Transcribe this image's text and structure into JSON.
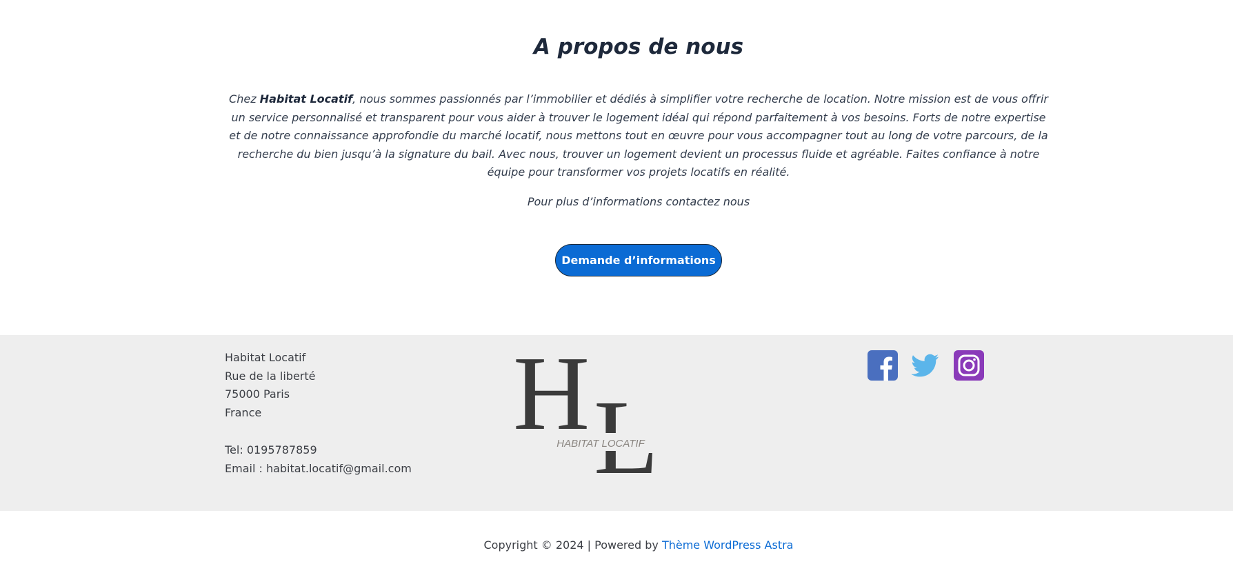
{
  "about": {
    "title": "A propos de nous",
    "intro_prefix": "Chez ",
    "company_name": "Habitat Locatif",
    "intro_body": ", nous sommes passionnés par l’immobilier et dédiés à simplifier votre recherche de location. Notre mission est de vous offrir un service personnalisé et transparent pour vous aider à trouver le logement idéal qui répond parfaitement à vos besoins. Forts de notre expertise et de notre connaissance approfondie du marché locatif, nous mettons tout en œuvre pour vous accompagner tout au long de votre parcours, de la recherche du bien jusqu’à la signature du bail. Avec nous, trouver un logement devient un processus fluide et agréable. Faites confiance à notre équipe pour transformer vos projets locatifs en réalité.",
    "contact_line": "Pour plus d’informations contactez nous",
    "cta_label": "Demande d’informations"
  },
  "footer": {
    "address": {
      "company": "Habitat Locatif",
      "street": "Rue de la liberté",
      "city": "75000 Paris",
      "country": "France",
      "phone": "Tel: 0195787859",
      "email": "Email : habitat.locatif@gmail.com"
    },
    "logo": {
      "monogram_top": "H",
      "monogram_bottom": "L",
      "tagline": "HABITAT LOCATIF"
    },
    "socials": [
      {
        "icon": "facebook-icon",
        "color": "#4a6fbf"
      },
      {
        "icon": "twitter-icon",
        "color": "#5bb5ea"
      },
      {
        "icon": "instagram-icon",
        "color": "#8a3ab9"
      }
    ]
  },
  "copyright": {
    "text": "Copyright © 2024 | Powered by ",
    "link_label": "Thème WordPress Astra"
  },
  "colors": {
    "accent": "#0b6bd4",
    "footer_bg": "#eeeeee",
    "heading": "#1e293b"
  }
}
